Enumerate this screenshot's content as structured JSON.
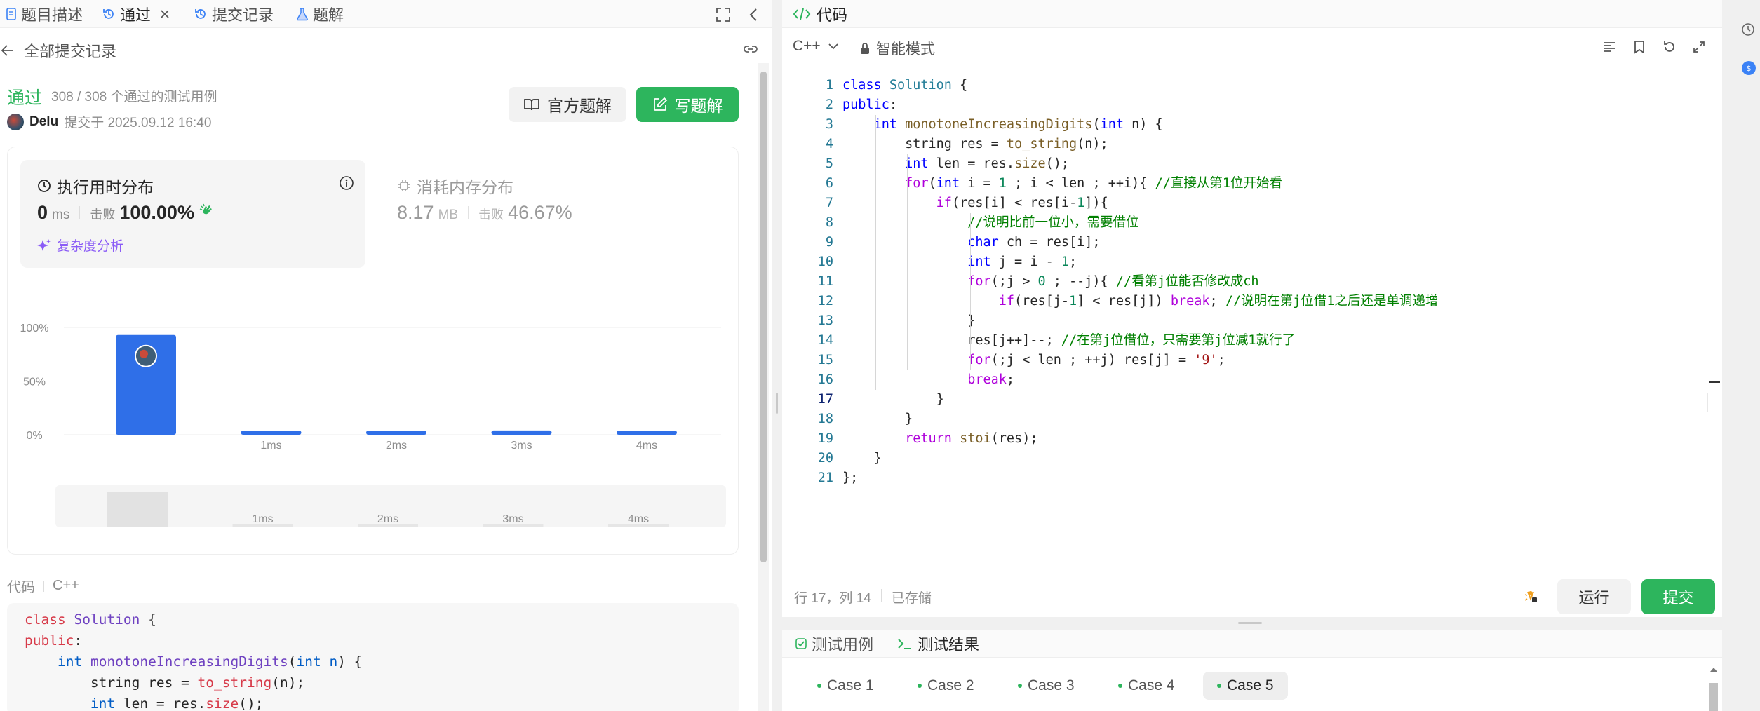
{
  "left_tabs": [
    {
      "label": "题目描述",
      "icon": "document-icon"
    },
    {
      "label": "通过",
      "icon": "history-icon"
    },
    {
      "label": "提交记录",
      "icon": "history-icon"
    },
    {
      "label": "题解",
      "icon": "flask-icon"
    }
  ],
  "back_label": "全部提交记录",
  "submission": {
    "status": "通过",
    "cases": "308 / 308 个通过的测试用例",
    "user": "Delu",
    "submitted_at": "提交于 2025.09.12 16:40",
    "official_solution_label": "官方题解",
    "write_solution_label": "写题解"
  },
  "runtime": {
    "title": "执行用时分布",
    "value": "0",
    "unit": "ms",
    "beats_label": "击败",
    "beats": "100.00%",
    "complexity_label": "复杂度分析"
  },
  "memory": {
    "title": "消耗内存分布",
    "value": "8.17",
    "unit": "MB",
    "beats_label": "击败",
    "beats": "46.67%"
  },
  "chart_data": {
    "type": "bar",
    "categories": [
      "0ms",
      "1ms",
      "2ms",
      "3ms",
      "4ms"
    ],
    "values": [
      93,
      3,
      3,
      4,
      3
    ],
    "y_ticks": [
      "100%",
      "50%",
      "0%"
    ],
    "x_tick_labels": [
      "",
      "1ms",
      "2ms",
      "3ms",
      "4ms"
    ],
    "ylim": [
      0,
      100
    ],
    "grid": true,
    "bar_color": "#2f6fe8"
  },
  "code_header": {
    "label": "代码",
    "lang": "C++"
  },
  "preview_code": [
    "class Solution {",
    "public:",
    "    int monotoneIncreasingDigits(int n) {",
    "        string res = to_string(n);",
    "        int len = res.size();"
  ],
  "editor": {
    "title": "代码",
    "language": "C++",
    "mode": "智能模式",
    "status_position": "行 17，列 14",
    "status_saved": "已存储",
    "run_label": "运行",
    "submit_label": "提交",
    "lines": [
      "class Solution {",
      "public:",
      "    int monotoneIncreasingDigits(int n) {",
      "        string res = to_string(n);",
      "        int len = res.size();",
      "        for(int i = 1 ; i < len ; ++i){ //直接从第1位开始看",
      "            if(res[i] < res[i-1]){",
      "                //说明比前一位小，需要借位",
      "                char ch = res[i];",
      "                int j = i - 1;",
      "                for(;j > 0 ; --j){ //看第j位能否修改成ch",
      "                    if(res[j-1] < res[j]) break; //说明在第j位借1之后还是单调递增",
      "                }",
      "                res[j++]--; //在第j位借位，只需要第j位减1就行了",
      "                for(;j < len ; ++j) res[j] = '9';",
      "                break;",
      "            }",
      "        }",
      "        return stoi(res);",
      "    }",
      "};"
    ]
  },
  "bottom_tabs": [
    {
      "label": "测试用例",
      "icon": "checkbox-icon"
    },
    {
      "label": "测试结果",
      "icon": "terminal-icon"
    }
  ],
  "cases": [
    "Case 1",
    "Case 2",
    "Case 3",
    "Case 4",
    "Case 5"
  ],
  "colors": {
    "accent_green": "#2db55d",
    "bar_blue": "#2f6fe8",
    "purple": "#8b5cf6"
  }
}
